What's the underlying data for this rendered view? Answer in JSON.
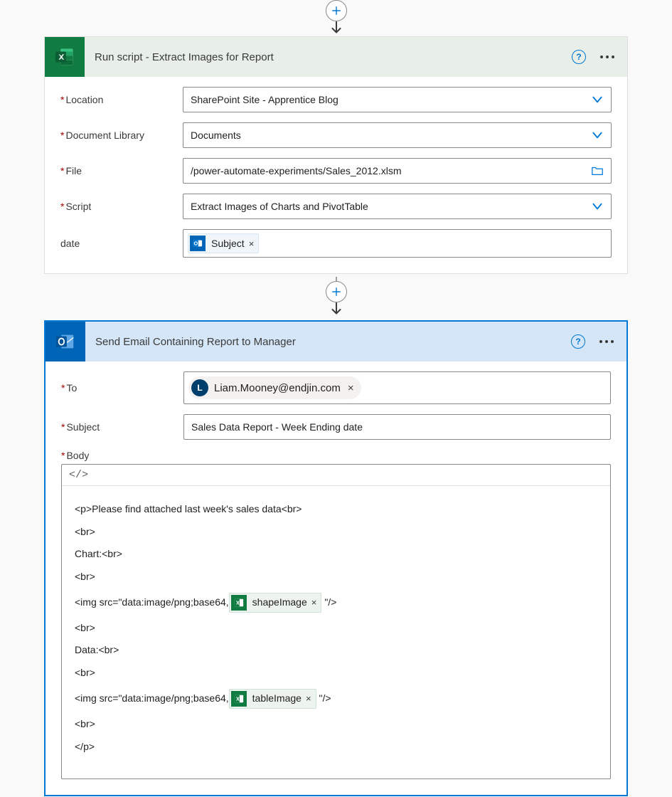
{
  "step1": {
    "title": "Run script - Extract Images for Report",
    "fields": {
      "location": {
        "label": "Location",
        "value": "SharePoint Site - Apprentice Blog"
      },
      "documentLibrary": {
        "label": "Document Library",
        "value": "Documents"
      },
      "file": {
        "label": "File",
        "value": "/power-automate-experiments/Sales_2012.xlsm"
      },
      "script": {
        "label": "Script",
        "value": "Extract Images of Charts and PivotTable"
      },
      "date": {
        "label": "date",
        "token": "Subject"
      }
    }
  },
  "step2": {
    "title": "Send Email Containing Report to Manager",
    "fields": {
      "to": {
        "label": "To",
        "recipient": {
          "initial": "L",
          "email": "Liam.Mooney@endjin.com"
        }
      },
      "subject": {
        "label": "Subject",
        "value": "Sales Data Report - Week Ending date"
      },
      "body": {
        "label": "Body",
        "toolbarHint": "</>"
      }
    },
    "bodyLines": {
      "l1": "<p>Please find attached last week's sales data<br>",
      "l2": "<br>",
      "l3": "Chart:<br>",
      "l4": "<br>",
      "l5a": "<img src=\"data:image/png;base64,",
      "l5token": "shapeImage",
      "l5b": "\"/>",
      "l6": "<br>",
      "l7": "Data:<br>",
      "l8": "<br>",
      "l9a": "<img src=\"data:image/png;base64,",
      "l9token": "tableImage",
      "l9b": "\"/>",
      "l10": "<br>",
      "l11": "</p>"
    }
  }
}
